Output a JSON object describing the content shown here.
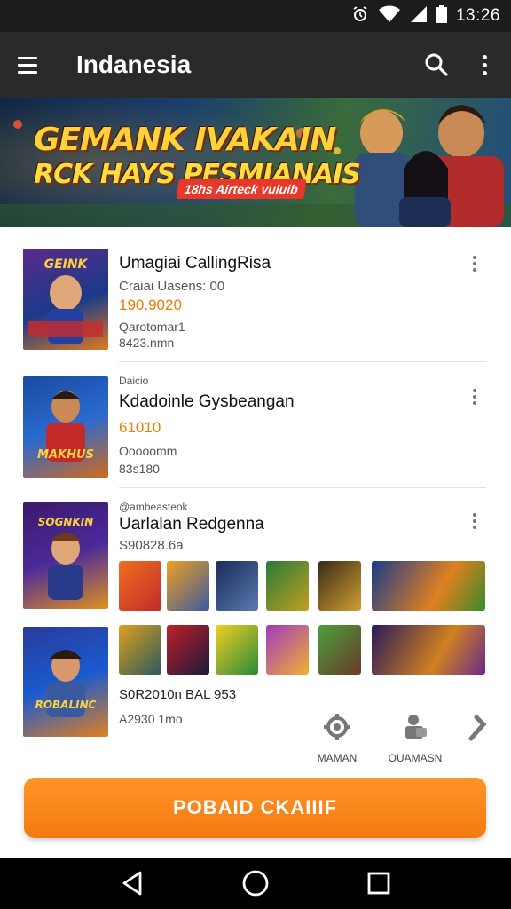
{
  "status_bar": {
    "time": "13:26"
  },
  "app_bar": {
    "title": "Indanesia"
  },
  "banner": {
    "headline_line1": "GEMANK IVAKAIN",
    "headline_line2": "RCK HAYS PESMIANAIS",
    "tag": "18hs Airteck vuluib"
  },
  "list": [
    {
      "name": "Umagiai CallingRisa",
      "sub": "Craiai Uasens: 00",
      "price": "190.9020",
      "line1": "Qarotomar1",
      "line2": "8423.nmn",
      "thumb_text": "GEINK"
    },
    {
      "label": "Daicio",
      "name": "Kdadoinle Gysbeangan",
      "price": "61010",
      "line1": "Ooooomm",
      "line2": "83s180",
      "thumb_text": "MAKHUS"
    },
    {
      "label": "@ambeasteok",
      "name": "Uarlalan Redgenna",
      "sub": "S90828.6a",
      "thumb_text": "SOGNKIN"
    },
    {
      "sub": "S0R2010n BAL 953",
      "line1": "A2930 1mo",
      "thumb_text": "ROBALINC"
    }
  ],
  "mini_tiles_row1": [
    "tile-1",
    "tile-2",
    "tile-3",
    "tile-4",
    "tile-5",
    "tile-6"
  ],
  "mini_tiles_row2": [
    "tile-7",
    "tile-8",
    "tile-9",
    "tile-10",
    "tile-11",
    "tile-12"
  ],
  "actions": [
    {
      "label": "MAMAN",
      "icon": "gear-icon"
    },
    {
      "label": "OUAMASN",
      "icon": "user-bag-icon"
    },
    {
      "label": "",
      "icon": "arrow-icon"
    }
  ],
  "cta": {
    "label": "POBAID CKAIIIF"
  },
  "colors": {
    "accent": "#f47a10",
    "appbar": "#2a2a2a",
    "price": "#f07b00"
  }
}
